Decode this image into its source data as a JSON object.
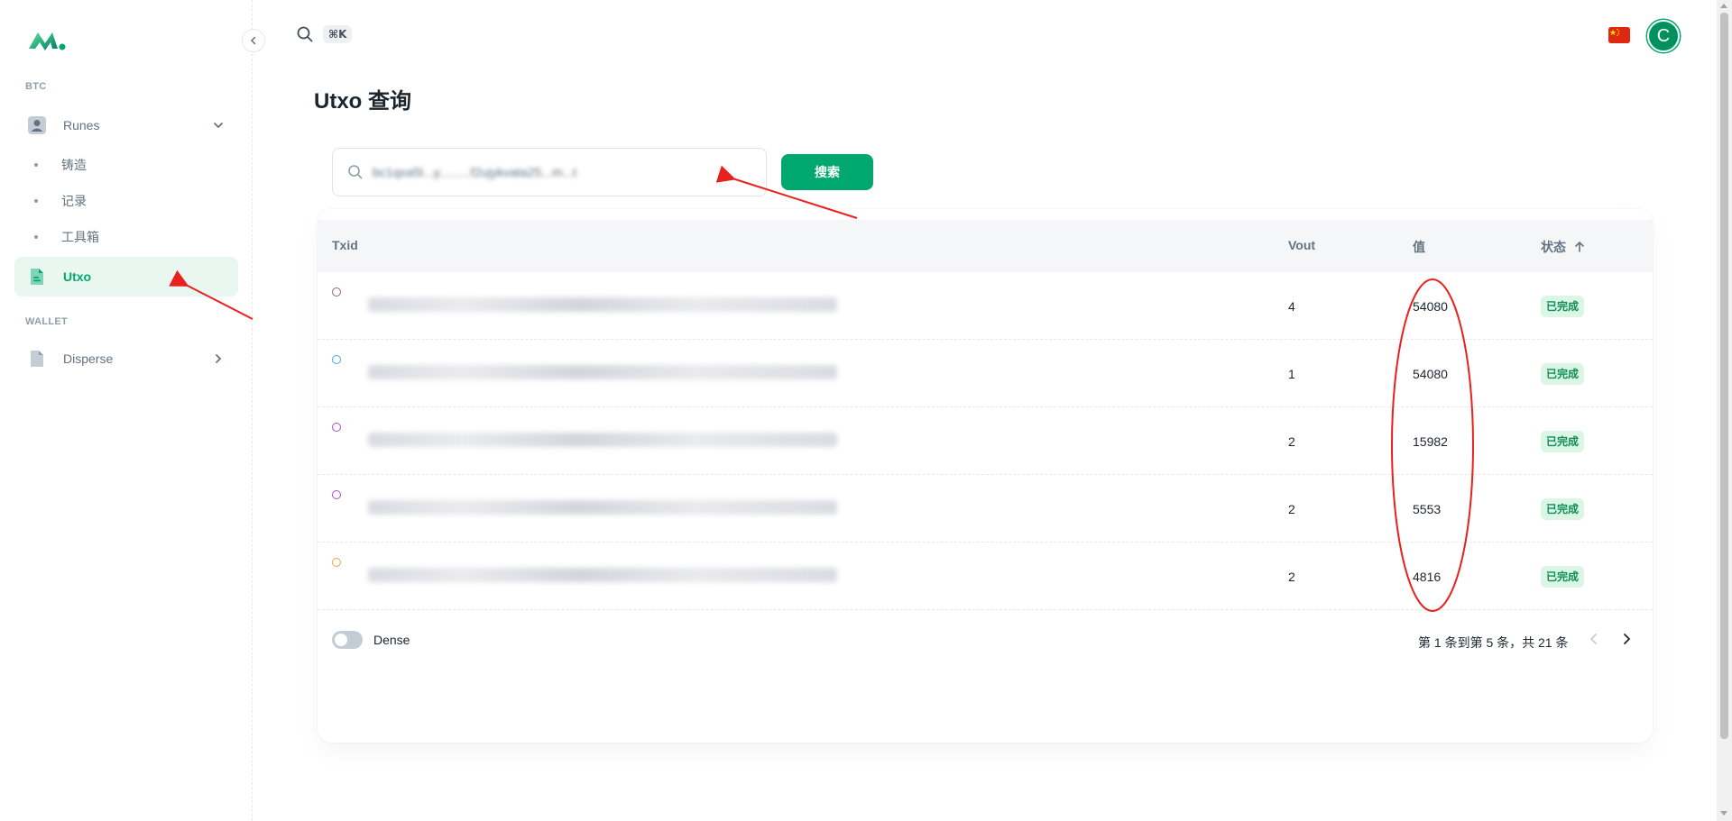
{
  "sidebar": {
    "sections": [
      {
        "label": "BTC"
      },
      {
        "label": "WALLET"
      }
    ],
    "runes": {
      "label": "Runes",
      "icon": "user-square-icon"
    },
    "sub_items": [
      {
        "label": "铸造"
      },
      {
        "label": "记录"
      },
      {
        "label": "工具箱"
      }
    ],
    "utxo": {
      "label": "Utxo",
      "icon": "file-icon"
    },
    "disperse": {
      "label": "Disperse",
      "icon": "file-icon"
    }
  },
  "topbar": {
    "shortcut": "⌘K",
    "avatar_initial": "C"
  },
  "page": {
    "title": "Utxo 查询",
    "search_value": "bc1qxa5l...y.........f2ujykvata25...m...t",
    "search_button": "搜索"
  },
  "table": {
    "headers": {
      "txid": "Txid",
      "vout": "Vout",
      "value": "值",
      "status": "状态"
    },
    "rows": [
      {
        "vout": "4",
        "value": "54080",
        "status": "已完成",
        "ring_color": "#8a6a6a"
      },
      {
        "vout": "1",
        "value": "54080",
        "status": "已完成",
        "ring_color": "#4aa3e0"
      },
      {
        "vout": "2",
        "value": "15982",
        "status": "已完成",
        "ring_color": "#b04cc4"
      },
      {
        "vout": "2",
        "value": "5553",
        "status": "已完成",
        "ring_color": "#b04cc4"
      },
      {
        "vout": "2",
        "value": "4816",
        "status": "已完成",
        "ring_color": "#f0a63a"
      }
    ]
  },
  "footer": {
    "dense_label": "Dense",
    "pagination": "第 1 条到第 5 条，共 21 条"
  },
  "colors": {
    "primary": "#00a76f",
    "annotation": "#e8211c"
  }
}
